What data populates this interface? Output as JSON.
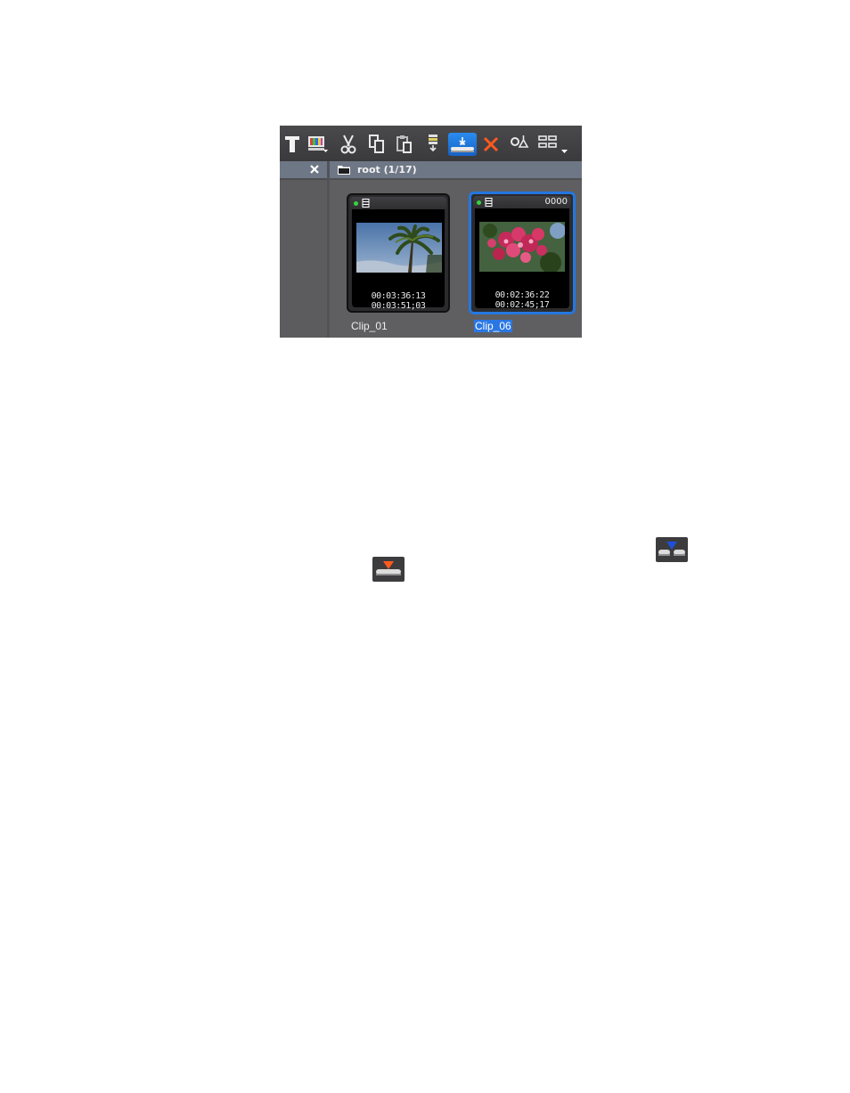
{
  "toolbar": {
    "buttons": [
      {
        "name": "title-icon"
      },
      {
        "name": "color-bars-icon"
      },
      {
        "name": "cut-icon"
      },
      {
        "name": "copy-icon"
      },
      {
        "name": "paste-icon"
      },
      {
        "name": "insert-to-timeline-icon"
      },
      {
        "name": "overwrite-to-timeline-icon",
        "active": true
      },
      {
        "name": "delete-icon"
      },
      {
        "name": "properties-icon"
      },
      {
        "name": "view-mode-icon"
      }
    ]
  },
  "folder_pane": {
    "close_label": "×"
  },
  "path_bar": {
    "label": "root (1/17)"
  },
  "clips": [
    {
      "name": "Clip_01",
      "badge": "",
      "tc_in": "00:03:36:13",
      "tc_out": "00:03:51;03",
      "selected": false,
      "thumbnail": "palm-tree"
    },
    {
      "name": "Clip_06",
      "badge": "0000",
      "tc_in": "00:02:36:22",
      "tc_out": "00:02:45;17",
      "selected": true,
      "thumbnail": "pink-flowers"
    }
  ],
  "inline_icons": [
    {
      "name": "insert-mode-icon",
      "arrow_color": "#1e50d8"
    },
    {
      "name": "overwrite-mode-icon",
      "arrow_color": "#ff5a1e"
    }
  ]
}
